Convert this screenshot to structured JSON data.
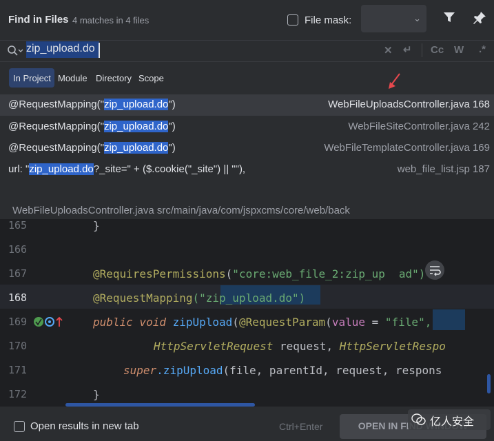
{
  "header": {
    "title": "Find in Files",
    "matches": "4 matches in 4 files",
    "file_mask_label": "File mask:"
  },
  "search": {
    "value": "zip_upload.do"
  },
  "scope_tabs": [
    "In Project",
    "Module",
    "Directory",
    "Scope"
  ],
  "results": [
    {
      "prefix": "@RequestMapping(\"",
      "match": "zip_upload.do",
      "suffix": "\")",
      "file": "WebFileUploadsController.java 168"
    },
    {
      "prefix": "@RequestMapping(\"",
      "match": "zip_upload.do",
      "suffix": "\")",
      "file": "WebFileSiteController.java 242"
    },
    {
      "prefix": "@RequestMapping(\"",
      "match": "zip_upload.do",
      "suffix": "\")",
      "file": "WebFileTemplateController.java 169"
    },
    {
      "prefix": "url: \"",
      "match": "zip_upload.do",
      "suffix": "?_site=\" + ($.cookie(\"_site\") || \"\"),",
      "file": "web_file_list.jsp 187"
    }
  ],
  "path_bar": "WebFileUploadsController.java  src/main/java/com/jspxcms/core/web/back",
  "editor": {
    "line_numbers": [
      "165",
      "166",
      "167",
      "168",
      "169",
      "170",
      "171",
      "172"
    ],
    "lines": {
      "l165": "}",
      "l167_ann": "@RequiresPermissions",
      "l167_open": "(",
      "l167_str": "\"core:web_file_2:zip_up",
      "l167_tail": "ad\")",
      "l168_ann": "@RequestMapping",
      "l168_open": "(\"",
      "l168_match": "zip_upload.do",
      "l168_close": "\")",
      "l169_kw": "public void",
      "l169_fn": " zipUpload",
      "l169_p1": "(",
      "l169_ann": "@RequestParam",
      "l169_p2": "(",
      "l169_par": "value",
      "l169_eq": " = ",
      "l169_q1": "\"",
      "l169_file": "file",
      "l169_q2": "\",",
      "l170_type1": "HttpServletRequest",
      "l170_mid": " request, ",
      "l170_type2": "HttpServletRespo",
      "l171_sup": "super",
      "l171_fn": ".zipUpload",
      "l171_rest": "(file, parentId, request, respons",
      "l172": "}"
    }
  },
  "footer": {
    "new_tab_label": "Open results in new tab",
    "shortcut": "Ctrl+Enter",
    "open_button": "OPEN IN FIND WINDOW"
  },
  "watermark": "亿人安全",
  "colors": {
    "background": "#2b2d30",
    "editor_background": "#1e1f22",
    "match_highlight": "#2f65ca",
    "annotation": "#b3ae60",
    "keyword": "#cf8e6d",
    "string": "#6aab73",
    "function": "#56a8f5",
    "arrow": "#e5484d"
  }
}
